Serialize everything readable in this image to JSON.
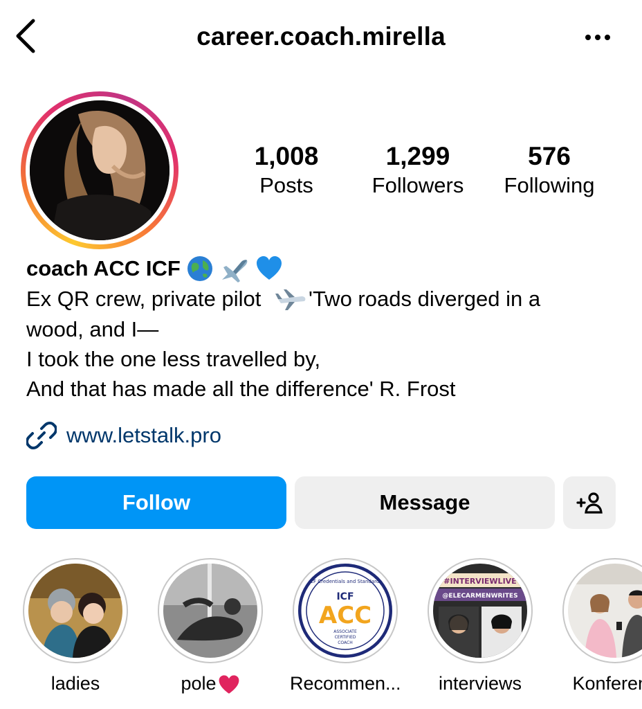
{
  "header": {
    "username": "career.coach.mirella"
  },
  "stats": [
    {
      "value": "1,008",
      "label": "Posts"
    },
    {
      "value": "1,299",
      "label": "Followers"
    },
    {
      "value": "576",
      "label": "Following"
    }
  ],
  "bio": {
    "name": "coach ACC ICF",
    "lines": [
      "Ex QR crew, private pilot",
      "'Two roads diverged in a",
      "wood, and I—",
      "I took the one less travelled by,",
      "And that has made all the difference' R. Frost"
    ],
    "link": "www.letstalk.pro"
  },
  "actions": {
    "follow": "Follow",
    "message": "Message"
  },
  "highlights": [
    {
      "label": "ladies"
    },
    {
      "label": "pole"
    },
    {
      "label": "Recommen..."
    },
    {
      "label": "interviews"
    },
    {
      "label": "Konferenc"
    }
  ],
  "highlight_art": {
    "acc_top": "ICF Credentials and Standards",
    "acc_brand": "ICF",
    "acc_big": "ACC",
    "acc_sub1": "ASSOCIATE",
    "acc_sub2": "CERTIFIED",
    "acc_sub3": "COACH",
    "iv_tag1": "#INTERVIEWLIVE",
    "iv_tag2": "@ELECARMENWRITES"
  },
  "colors": {
    "follow_blue": "#0095f6",
    "link_blue": "#00376b",
    "button_grey": "#efefef"
  }
}
